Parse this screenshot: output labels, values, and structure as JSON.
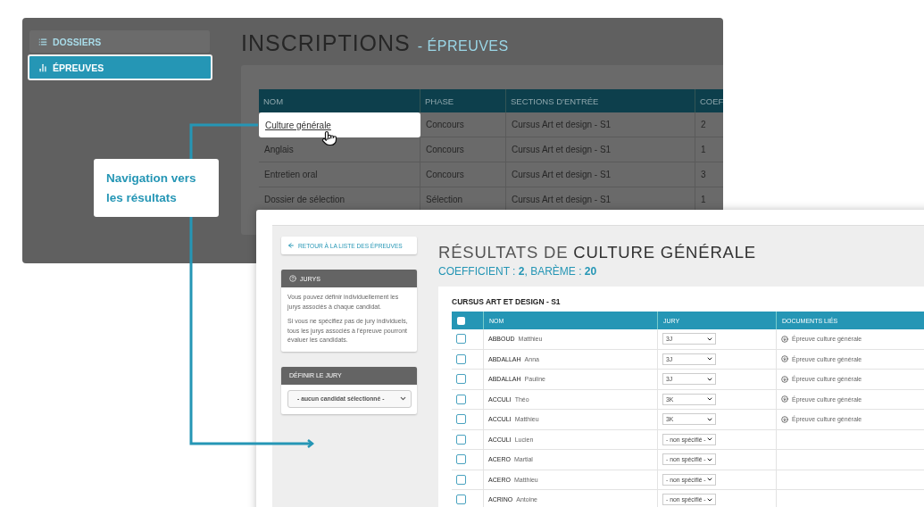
{
  "back_screen": {
    "sidebar": {
      "items": [
        {
          "label": "DOSSIERS",
          "selected": false
        },
        {
          "label": "ÉPREUVES",
          "selected": true
        }
      ]
    },
    "title": "INSCRIPTIONS",
    "subtitle": "- ÉPREUVES",
    "table": {
      "columns": [
        "NOM",
        "PHASE",
        "SECTIONS D'ENTRÉE",
        "COEF"
      ],
      "rows": [
        {
          "cells": [
            "Culture générale",
            "Concours",
            "Cursus Art et design - S1",
            "2"
          ],
          "highlighted": true
        },
        {
          "cells": [
            "Anglais",
            "Concours",
            "Cursus Art et design - S1",
            "1"
          ],
          "highlighted": false
        },
        {
          "cells": [
            "Entretien oral",
            "Concours",
            "Cursus Art et design - S1",
            "3"
          ],
          "highlighted": false
        },
        {
          "cells": [
            "Dossier de sélection",
            "Sélection",
            "Cursus Art et design - S1",
            "1"
          ],
          "highlighted": false
        }
      ]
    }
  },
  "callout": {
    "text": "Navigation vers les résultats"
  },
  "front_screen": {
    "back_button": "RETOUR À LA LISTE DES ÉPREUVES",
    "jurys_panel": {
      "title": "JURYS",
      "paragraphs": [
        "Vous pouvez définir individuellement les jurys associés à chaque candidat.",
        "Si vous ne spécifiez pas de jury individuels, tous les jurys associés à l'épreuve pourront évaluer les candidats."
      ]
    },
    "jury_panel": {
      "title": "DÉFINIR LE JURY",
      "select": "- aucun candidat sélectionné -"
    },
    "title": "RÉSULTATS DE **CULTURE GÉNÉRALE**",
    "subtitle": "COEFFICIENT : **2**, BARÈME : **20**",
    "section": "CURSUS ART ET DESIGN - S1",
    "table": {
      "select_all": {
        "checked": false
      },
      "columns": [
        "NOM",
        "JURY",
        "DOCUMENTS LIÉS"
      ],
      "rows": [
        {
          "name": "**ABBOUD** Matthieu",
          "jury": "3J",
          "document": "Épreuve culture générale",
          "checked": false
        },
        {
          "name": "**ABDALLAH** Anna",
          "jury": "3J",
          "document": "Épreuve culture générale",
          "checked": false
        },
        {
          "name": "**ABDALLAH** Pauline",
          "jury": "3J",
          "document": "Épreuve culture générale",
          "checked": false
        },
        {
          "name": "**ACCULI** Théo",
          "jury": "3K",
          "document": "Épreuve culture générale",
          "checked": false
        },
        {
          "name": "**ACCULI** Matthieu",
          "jury": "3K",
          "document": "Épreuve culture générale",
          "checked": false
        },
        {
          "name": "**ACCULI** Lucien",
          "jury": "- non spécifié -",
          "checked": false
        },
        {
          "name": "**ACERO** Martial",
          "jury": "- non spécifié -",
          "checked": false
        },
        {
          "name": "**ACERO** Matthieu",
          "jury": "- non spécifié -",
          "checked": false
        },
        {
          "name": "**ACRINO** Antoine",
          "jury": "- non spécifié -",
          "checked": false
        }
      ]
    }
  }
}
